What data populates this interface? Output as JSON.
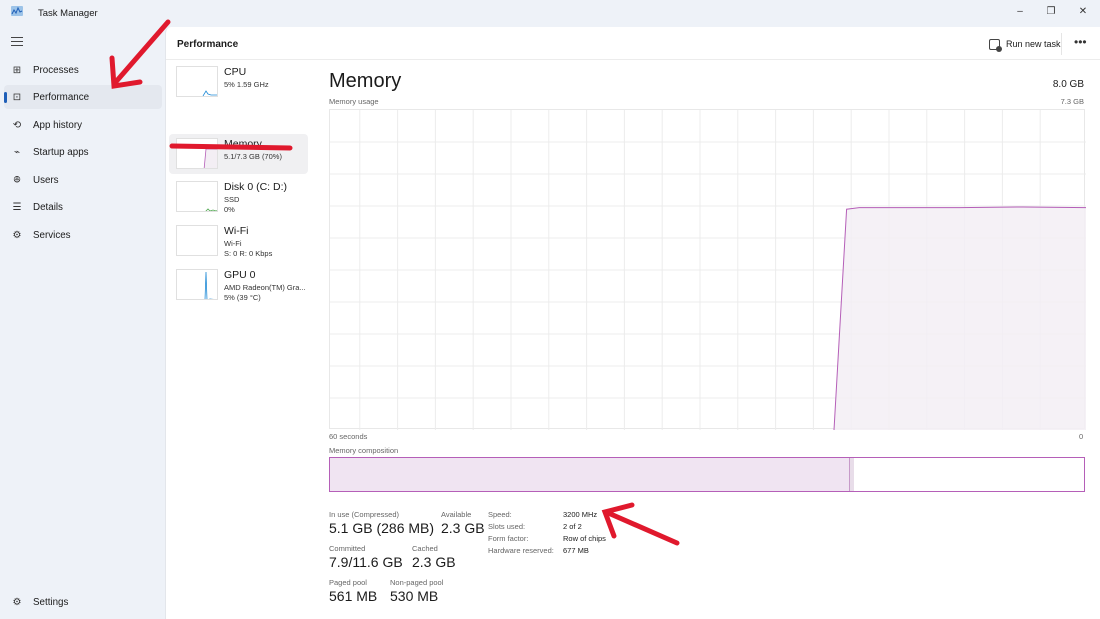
{
  "window": {
    "title": "Task Manager",
    "controls": {
      "minimize": "–",
      "maximize": "❐",
      "close": "✕"
    }
  },
  "sidebar": {
    "menu_icon": "hamburger-icon",
    "items": [
      {
        "label": "Processes",
        "icon": "processes-icon",
        "glyph": "⊞"
      },
      {
        "label": "Performance",
        "icon": "performance-icon",
        "glyph": "⊡",
        "active": true
      },
      {
        "label": "App history",
        "icon": "history-icon",
        "glyph": "⟲"
      },
      {
        "label": "Startup apps",
        "icon": "startup-icon",
        "glyph": "⌁"
      },
      {
        "label": "Users",
        "icon": "users-icon",
        "glyph": "ꔮ"
      },
      {
        "label": "Details",
        "icon": "details-icon",
        "glyph": "☰"
      },
      {
        "label": "Services",
        "icon": "services-icon",
        "glyph": "⚙"
      }
    ],
    "settings": {
      "label": "Settings",
      "icon": "settings-icon",
      "glyph": "⚙"
    }
  },
  "command_bar": {
    "title": "Performance",
    "run_new_task": "Run new task",
    "more": "•••"
  },
  "devices": [
    {
      "name": "CPU",
      "line1": "5%  1.59 GHz",
      "line2": "",
      "color": "#1f8ad6"
    },
    {
      "name": "Memory",
      "line1": "5.1/7.3 GB (70%)",
      "line2": "",
      "color": "#b55fb8",
      "active": true
    },
    {
      "name": "Disk 0 (C: D:)",
      "line1": "SSD",
      "line2": "0%",
      "color": "#4ca64c"
    },
    {
      "name": "Wi-Fi",
      "line1": "Wi-Fi",
      "line2": "S: 0 R: 0 Kbps",
      "color": "#b07a2a"
    },
    {
      "name": "GPU 0",
      "line1": "AMD Radeon(TM) Gra...",
      "line2": "5%  (39 °C)",
      "color": "#1f8ad6"
    }
  ],
  "memory": {
    "title": "Memory",
    "total": "8.0 GB",
    "usage_label": "Memory usage",
    "usage_max": "7.3 GB",
    "x_left": "60 seconds",
    "x_right": "0",
    "composition_label": "Memory composition",
    "composition": {
      "in_use_fraction": 0.69,
      "modified_fraction": 0.005
    },
    "stats": {
      "in_use_label": "In use (Compressed)",
      "in_use_value": "5.1 GB (286 MB)",
      "available_label": "Available",
      "available_value": "2.3 GB",
      "committed_label": "Committed",
      "committed_value": "7.9/11.6 GB",
      "cached_label": "Cached",
      "cached_value": "2.3 GB",
      "paged_label": "Paged pool",
      "paged_value": "561 MB",
      "nonpaged_label": "Non-paged pool",
      "nonpaged_value": "530 MB"
    },
    "specs": [
      {
        "label": "Speed:",
        "value": "3200 MHz"
      },
      {
        "label": "Slots used:",
        "value": "2 of 2"
      },
      {
        "label": "Form factor:",
        "value": "Row of chips"
      },
      {
        "label": "Hardware reserved:",
        "value": "677 MB"
      }
    ],
    "line_color": "#b55fb8",
    "fill_color": "#f3eef4"
  },
  "chart_data": {
    "type": "area",
    "title": "Memory usage",
    "xlabel": "",
    "ylabel": "",
    "x_range_seconds": [
      60,
      0
    ],
    "ylim_gb": [
      0,
      7.3
    ],
    "x_seconds_ago": [
      60,
      20,
      19,
      18,
      15,
      10,
      5,
      0
    ],
    "values_percent": [
      null,
      0,
      69,
      69.5,
      69.5,
      69.5,
      69.7,
      69.5
    ],
    "grid": true,
    "x_tick_labels": [
      "60 seconds",
      "0"
    ]
  },
  "annotations": {
    "color": "#e0192d"
  }
}
